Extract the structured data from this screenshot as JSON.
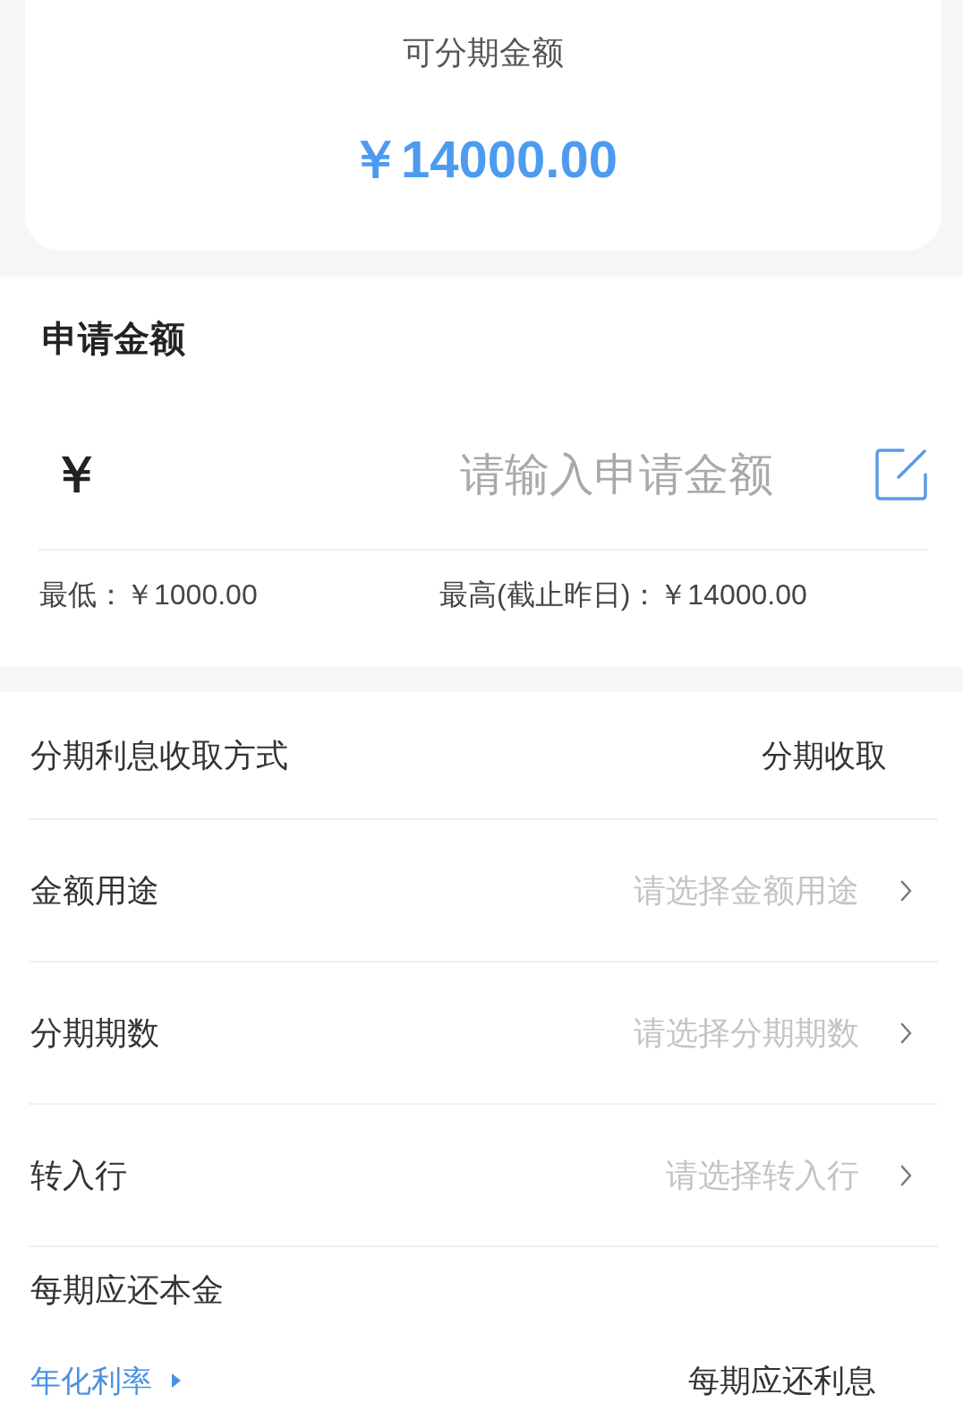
{
  "summary": {
    "label": "可分期金额",
    "amount": "￥14000.00"
  },
  "apply": {
    "title": "申请金额",
    "currency": "￥",
    "input": {
      "placeholder": "请输入申请金额"
    },
    "min": "最低：￥1000.00",
    "max": "最高(截止昨日)：￥14000.00"
  },
  "rows": [
    {
      "kind": "value",
      "label": "分期利息收取方式",
      "value": "分期收取"
    },
    {
      "kind": "select",
      "label": "金额用途",
      "placeholder": "请选择金额用途"
    },
    {
      "kind": "select",
      "label": "分期期数",
      "placeholder": "请选择分期期数"
    },
    {
      "kind": "select",
      "label": "转入行",
      "placeholder": "请选择转入行"
    }
  ],
  "repayment": {
    "principal_label": "每期应还本金",
    "rate_link": "年化利率",
    "interest_label": "每期应还利息"
  }
}
